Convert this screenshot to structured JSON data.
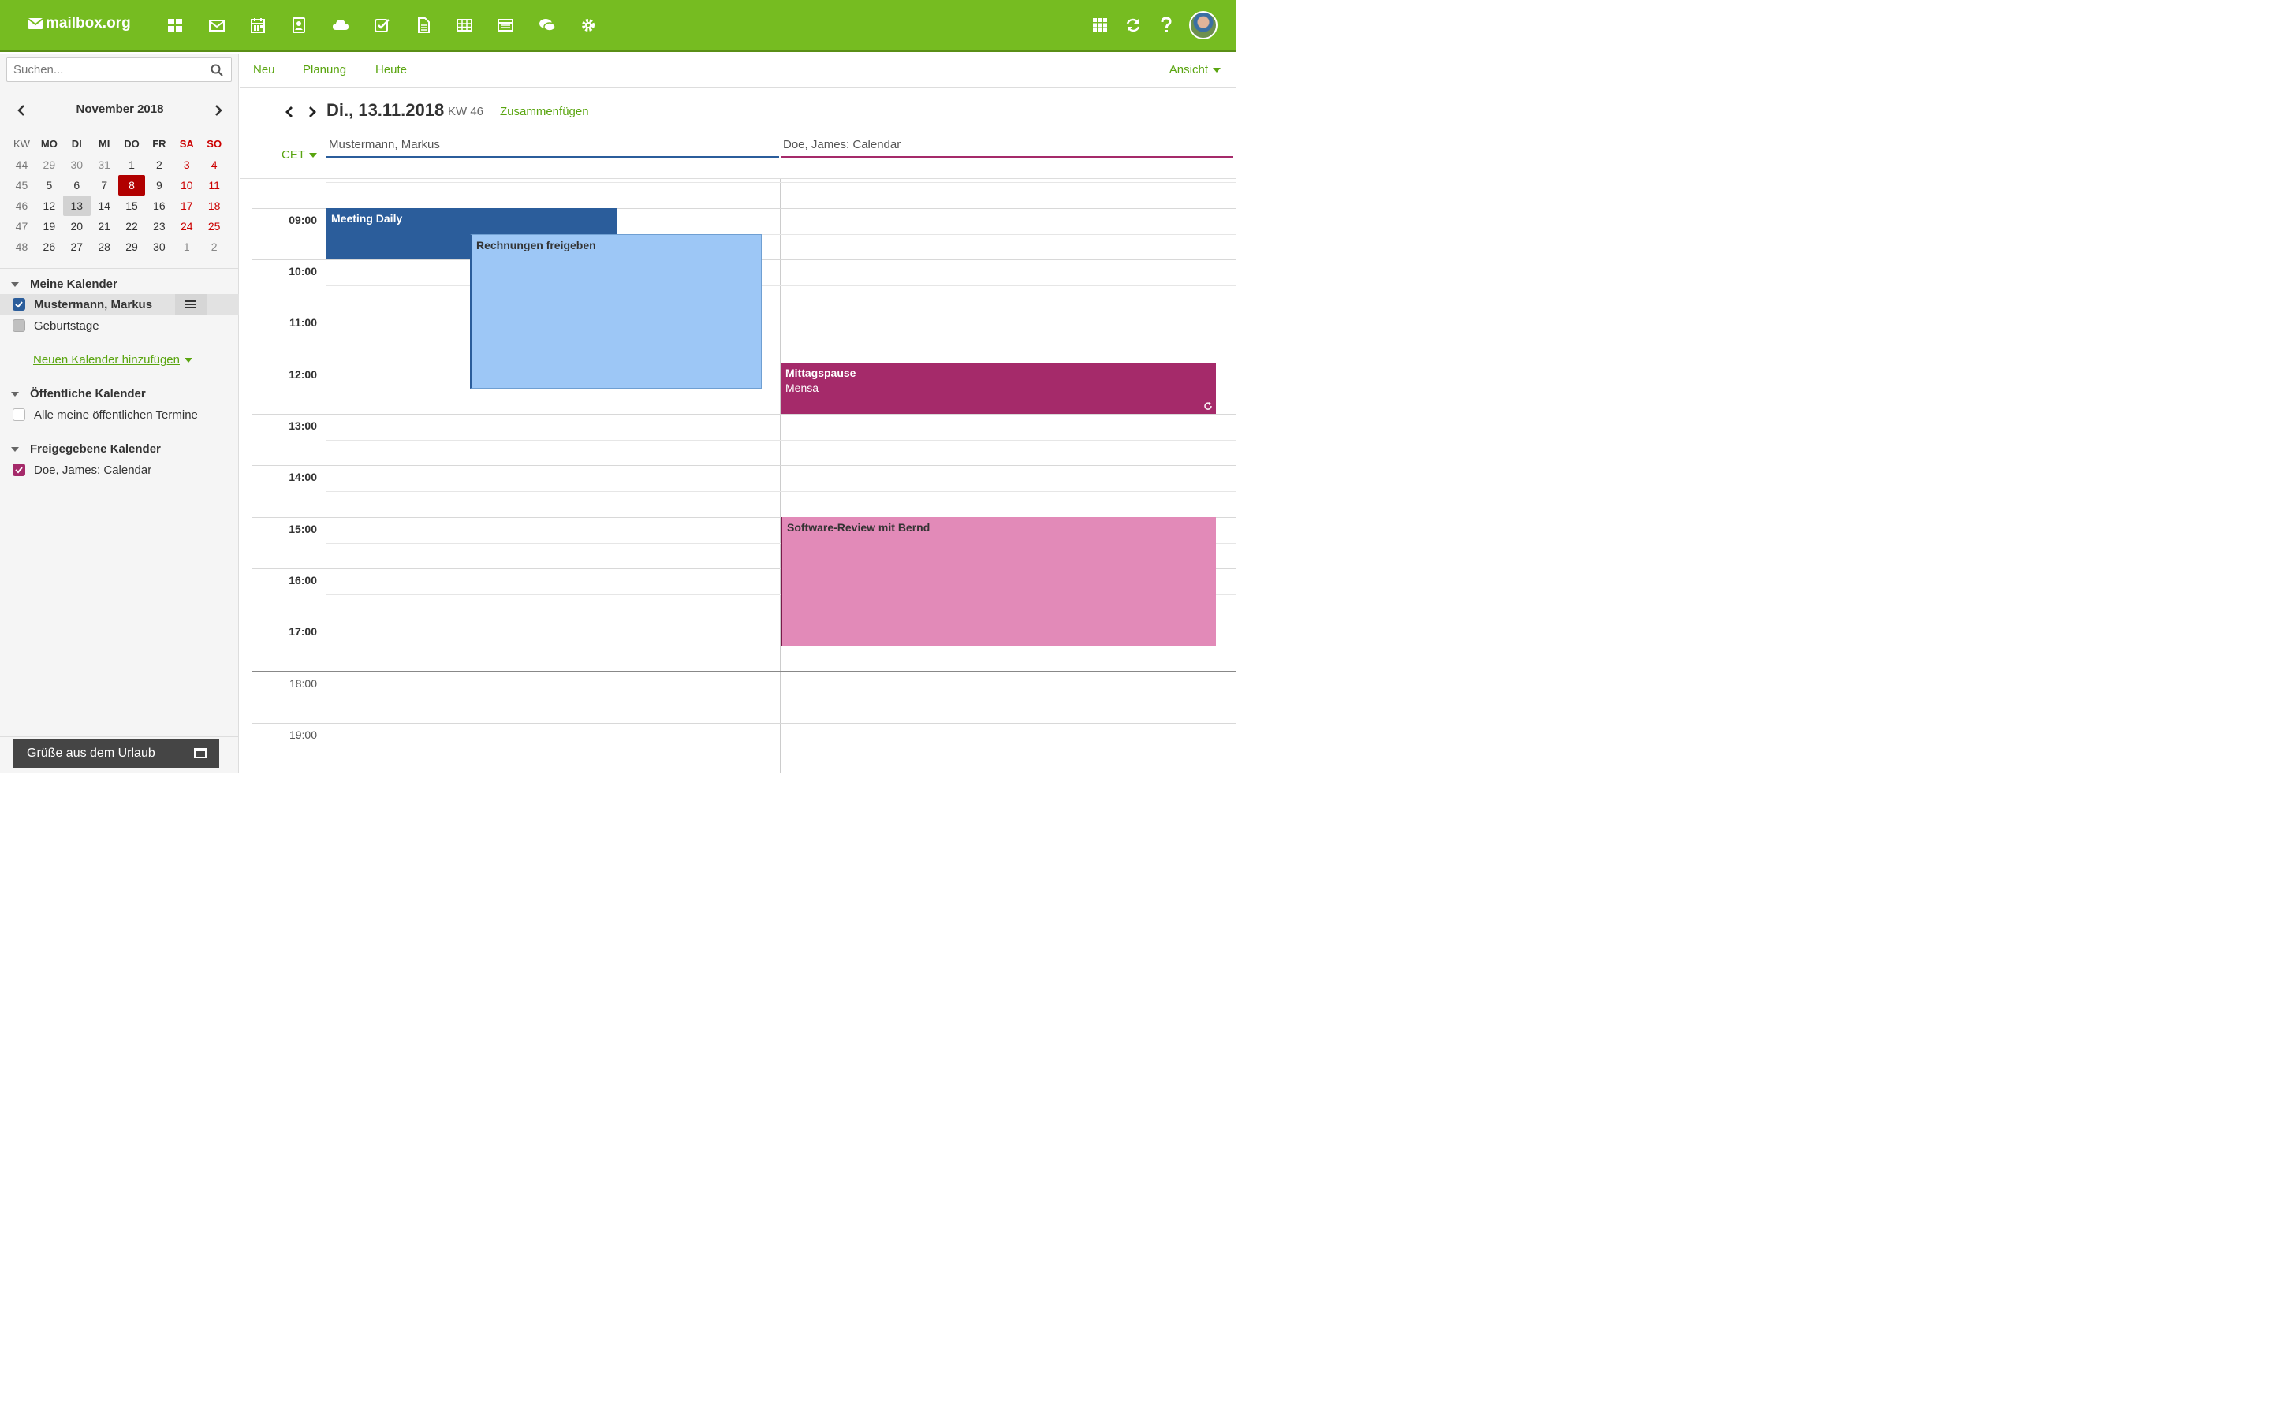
{
  "header": {
    "brand": "mailbox.org",
    "app_icons": [
      "dashboard-icon",
      "mail-icon",
      "calendar-icon",
      "contacts-icon",
      "cloud-icon",
      "tasks-icon",
      "document-icon",
      "spreadsheet-icon",
      "presentation-icon",
      "chat-icon",
      "settings-icon"
    ],
    "right_icons": [
      "apps-grid-icon",
      "refresh-icon",
      "help-icon",
      "avatar"
    ],
    "accent_color": "#76bc21"
  },
  "sidebar": {
    "search_placeholder": "Suchen...",
    "minical": {
      "title": "November 2018",
      "headers": [
        "KW",
        "MO",
        "DI",
        "MI",
        "DO",
        "FR",
        "SA",
        "SO"
      ],
      "weeks": [
        [
          "44",
          "29",
          "30",
          "31",
          "1",
          "2",
          "3",
          "4"
        ],
        [
          "45",
          "5",
          "6",
          "7",
          "8",
          "9",
          "10",
          "11"
        ],
        [
          "46",
          "12",
          "13",
          "14",
          "15",
          "16",
          "17",
          "18"
        ],
        [
          "47",
          "19",
          "20",
          "21",
          "22",
          "23",
          "24",
          "25"
        ],
        [
          "48",
          "26",
          "27",
          "28",
          "29",
          "30",
          "1",
          "2"
        ]
      ],
      "today": "8",
      "selected": "13"
    },
    "my_calendars": {
      "title": "Meine Kalender",
      "items": [
        {
          "label": "Mustermann, Markus",
          "checked": true,
          "color": "#2b5d9b"
        },
        {
          "label": "Geburtstage",
          "checked": false,
          "color": "#c0c0c0"
        }
      ],
      "add_label": "Neuen Kalender hinzufügen"
    },
    "public_calendars": {
      "title": "Öffentliche Kalender",
      "items": [
        {
          "label": "Alle meine öffentlichen Termine",
          "checked": false
        }
      ]
    },
    "shared_calendars": {
      "title": "Freigegebene Kalender",
      "items": [
        {
          "label": "Doe, James: Calendar",
          "checked": true,
          "color": "#a52a6a"
        }
      ]
    },
    "vacation_label": "Grüße aus dem Urlaub"
  },
  "toolbar": {
    "new_label": "Neu",
    "planning_label": "Planung",
    "today_label": "Heute",
    "view_label": "Ansicht"
  },
  "day": {
    "date": "Di., 13.11.2018",
    "kw": "KW 46",
    "merge_label": "Zusammenfügen",
    "timezone": "CET",
    "columns": [
      "Mustermann, Markus",
      "Doe, James: Calendar"
    ]
  },
  "times": [
    "09:00",
    "10:00",
    "11:00",
    "12:00",
    "13:00",
    "14:00",
    "15:00",
    "16:00",
    "17:00",
    "18:00",
    "19:00"
  ],
  "events": {
    "meeting": {
      "title": "Meeting Daily",
      "color": "#2b5d9b"
    },
    "invoices": {
      "title": "Rechnungen freigeben",
      "color": "#9dc7f6"
    },
    "lunch": {
      "title": "Mittagspause",
      "location": "Mensa",
      "color": "#a52a6a"
    },
    "review": {
      "title": "Software-Review mit Bernd",
      "color": "#e28ab8"
    }
  }
}
